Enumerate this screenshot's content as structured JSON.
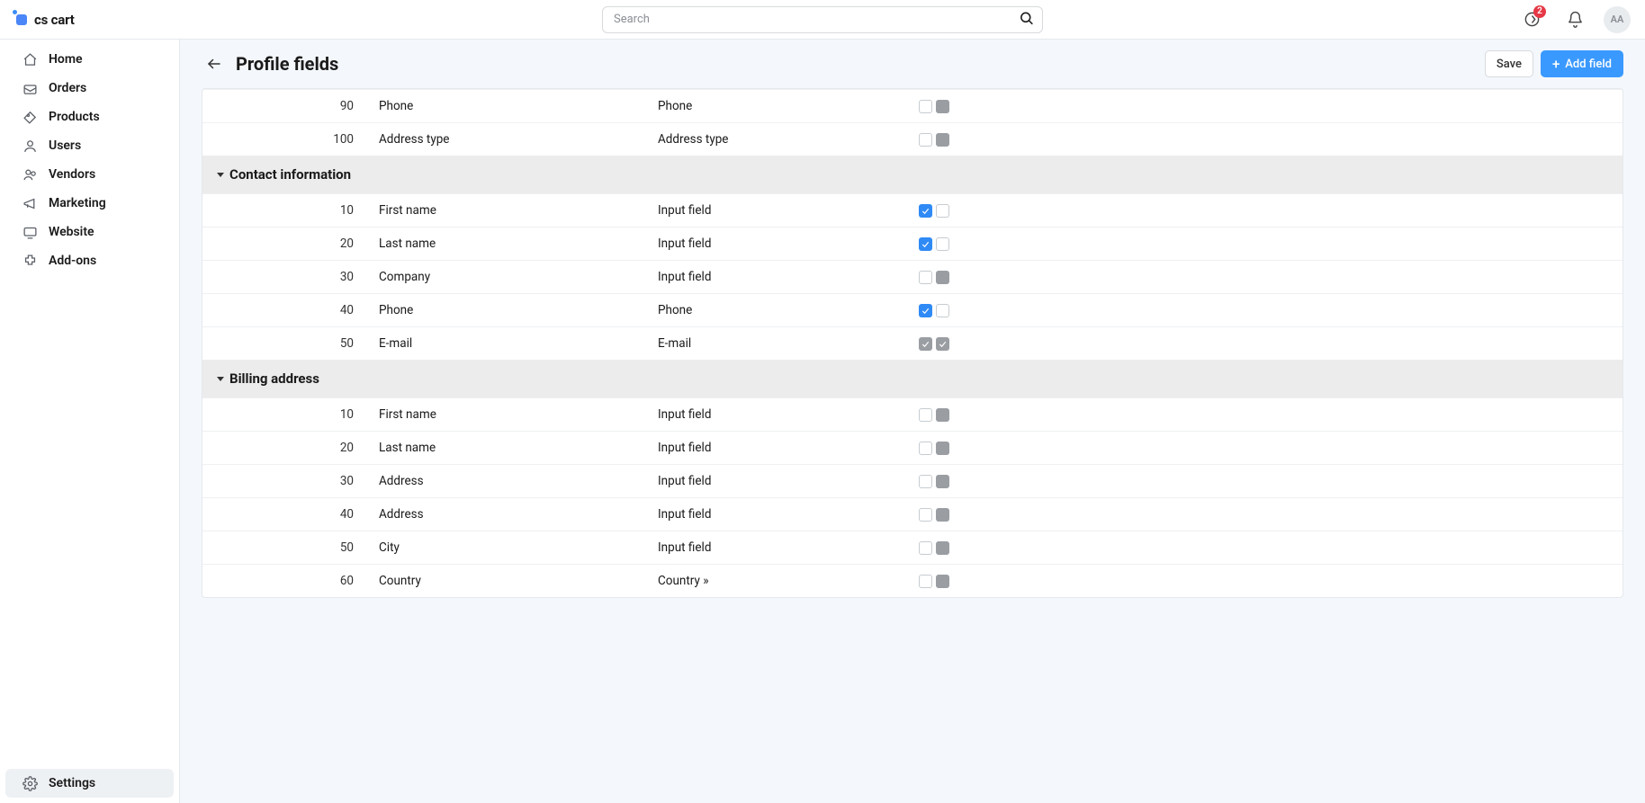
{
  "brand": "cs cart",
  "search": {
    "placeholder": "Search"
  },
  "notifications": {
    "count": "2"
  },
  "user": {
    "initials": "AA"
  },
  "sidebar": {
    "items": [
      {
        "label": "Home",
        "icon": "home"
      },
      {
        "label": "Orders",
        "icon": "orders"
      },
      {
        "label": "Products",
        "icon": "products"
      },
      {
        "label": "Users",
        "icon": "users"
      },
      {
        "label": "Vendors",
        "icon": "vendors"
      },
      {
        "label": "Marketing",
        "icon": "marketing"
      },
      {
        "label": "Website",
        "icon": "website"
      },
      {
        "label": "Add-ons",
        "icon": "addons"
      }
    ],
    "settings": {
      "label": "Settings"
    }
  },
  "page": {
    "title": "Profile fields",
    "save_label": "Save",
    "add_field_label": "Add field"
  },
  "sections": [
    {
      "heading": null,
      "rows": [
        {
          "pos": "90",
          "desc": "Phone",
          "type": "Phone",
          "cb1": "empty",
          "cb2": "grey"
        },
        {
          "pos": "100",
          "desc": "Address type",
          "type": "Address type",
          "cb1": "empty",
          "cb2": "grey"
        }
      ]
    },
    {
      "heading": "Contact information",
      "rows": [
        {
          "pos": "10",
          "desc": "First name",
          "type": "Input field",
          "cb1": "blue",
          "cb2": "empty"
        },
        {
          "pos": "20",
          "desc": "Last name",
          "type": "Input field",
          "cb1": "blue",
          "cb2": "empty"
        },
        {
          "pos": "30",
          "desc": "Company",
          "type": "Input field",
          "cb1": "empty",
          "cb2": "grey"
        },
        {
          "pos": "40",
          "desc": "Phone",
          "type": "Phone",
          "cb1": "blue",
          "cb2": "empty"
        },
        {
          "pos": "50",
          "desc": "E-mail",
          "type": "E-mail",
          "cb1": "greycheck",
          "cb2": "greycheck"
        }
      ]
    },
    {
      "heading": "Billing address",
      "rows": [
        {
          "pos": "10",
          "desc": "First name",
          "type": "Input field",
          "cb1": "empty",
          "cb2": "grey"
        },
        {
          "pos": "20",
          "desc": "Last name",
          "type": "Input field",
          "cb1": "empty",
          "cb2": "grey"
        },
        {
          "pos": "30",
          "desc": "Address",
          "type": "Input field",
          "cb1": "empty",
          "cb2": "grey"
        },
        {
          "pos": "40",
          "desc": "Address",
          "type": "Input field",
          "cb1": "empty",
          "cb2": "grey"
        },
        {
          "pos": "50",
          "desc": "City",
          "type": "Input field",
          "cb1": "empty",
          "cb2": "grey"
        },
        {
          "pos": "60",
          "desc": "Country",
          "type": "Country »",
          "cb1": "empty",
          "cb2": "grey"
        }
      ]
    }
  ]
}
